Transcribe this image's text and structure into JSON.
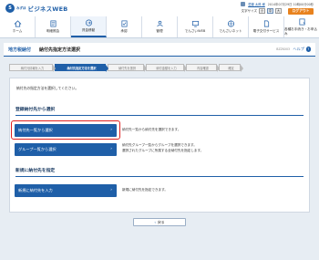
{
  "header": {
    "logo_mark": "S",
    "logo_small": "みずほ",
    "logo_text": "ビジネスWEB",
    "user_name": "愛媛 太郎 様",
    "last_login": "2014年07月29日 10時00分00秒",
    "font_size_label": "文字サイズ",
    "font_sizes": [
      "小",
      "中",
      "大"
    ],
    "logout_label": "ログアウト"
  },
  "nav": [
    {
      "label": "ホーム",
      "icon": "home-icon"
    },
    {
      "label": "明細照会",
      "icon": "statement-icon"
    },
    {
      "label": "資金移動",
      "icon": "transfer-icon"
    },
    {
      "label": "承認",
      "icon": "approval-icon"
    },
    {
      "label": "管理",
      "icon": "management-icon"
    },
    {
      "label": "でんさいWEB",
      "icon": "densai-icon"
    },
    {
      "label": "でんさいネット",
      "icon": "network-icon"
    },
    {
      "label": "電子交付サービス",
      "icon": "document-icon"
    },
    {
      "label": "各種お手続き・お申込み",
      "icon": "procedure-icon"
    }
  ],
  "title": {
    "category": "地方税納付",
    "main": "納付先指定方法選択",
    "code": "BZZK003",
    "help": "ヘルプ"
  },
  "steps": [
    "納付元情報を入力",
    "納付先指定方法を選択",
    "納付先を選択",
    "納付金額を入力",
    "内容確認",
    "確定"
  ],
  "intro": "納付先の指定方法を選択してください。",
  "section1": {
    "heading": "登録納付先から選択",
    "btn1_label": "納付先一覧から選択",
    "btn1_desc": "納付先一覧から納付先を選択できます。",
    "btn2_label": "グループ一覧から選択",
    "btn2_desc_line1": "納付先グループ一覧からグループを選択できます。",
    "btn2_desc_line2": "選択されたグループに所属する全納付先を指定します。"
  },
  "section2": {
    "heading": "新規に納付先を指定",
    "btn_label": "新規に納付先を入力",
    "btn_desc": "新規に納付先を指定できます。"
  },
  "back_label": "戻る",
  "colors": {
    "primary": "#1f5fa8",
    "logout": "#e8821e",
    "highlight": "#e02020"
  }
}
